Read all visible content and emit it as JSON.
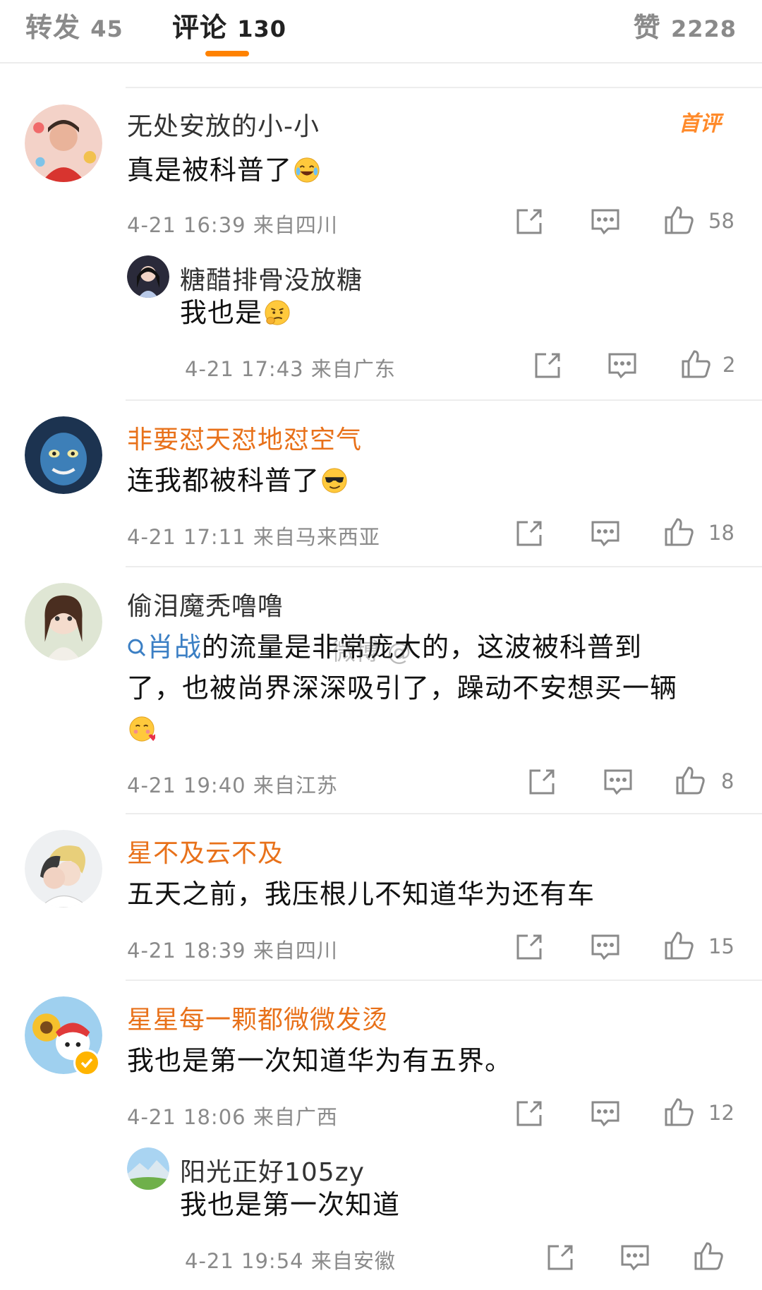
{
  "tabs": [
    {
      "label": "转发",
      "count": "45"
    },
    {
      "label": "评论",
      "count": "130"
    },
    {
      "label": "赞",
      "count": "2228"
    }
  ],
  "first_comment_badge": "首评",
  "watermark": "微博 @​",
  "comments": [
    {
      "username": "无处安放的小-小",
      "text": "真是被科普了",
      "emoji": "laugh-cry-emoji",
      "meta": "4-21 16:39 来自四川",
      "likes": "58",
      "reply": {
        "username": "糖醋排骨没放糖",
        "text": "我也是",
        "emoji": "thinking-emoji",
        "meta": "4-21 17:43 来自广东",
        "likes": "2"
      }
    },
    {
      "username": "非要怼天怼地怼空气",
      "text": "连我都被科普了",
      "emoji": "sunglasses-emoji",
      "meta": "4-21 17:11 来自马来西亚",
      "likes": "18"
    },
    {
      "username": "偷泪魔秃噜噜",
      "text_link": "肖战",
      "text_line1": "的流量是非常庞大的，这波被科普到",
      "text_line2": "了，也被尚界深深吸引了，躁动不安想买一辆",
      "emoji": "heart-cheeks-emoji",
      "meta": "4-21 19:40 来自江苏",
      "likes": "8"
    },
    {
      "username": "星不及云不及",
      "text": "五天之前，我压根儿不知道华为还有车",
      "meta": "4-21 18:39 来自四川",
      "likes": "15"
    },
    {
      "username": "星星每一颗都微微发烫",
      "text": "我也是第一次知道华为有五界。",
      "meta": "4-21 18:06 来自广西",
      "likes": "12",
      "reply": {
        "username": "阳光正好105zy",
        "text": "我也是第一次知道",
        "meta": "4-21 19:54 来自安徽",
        "likes": ""
      }
    }
  ],
  "colors": {
    "accent": "#ff8200",
    "vip_name": "#e8711a",
    "link": "#3b7fc4",
    "meta": "#8a8a8a"
  }
}
